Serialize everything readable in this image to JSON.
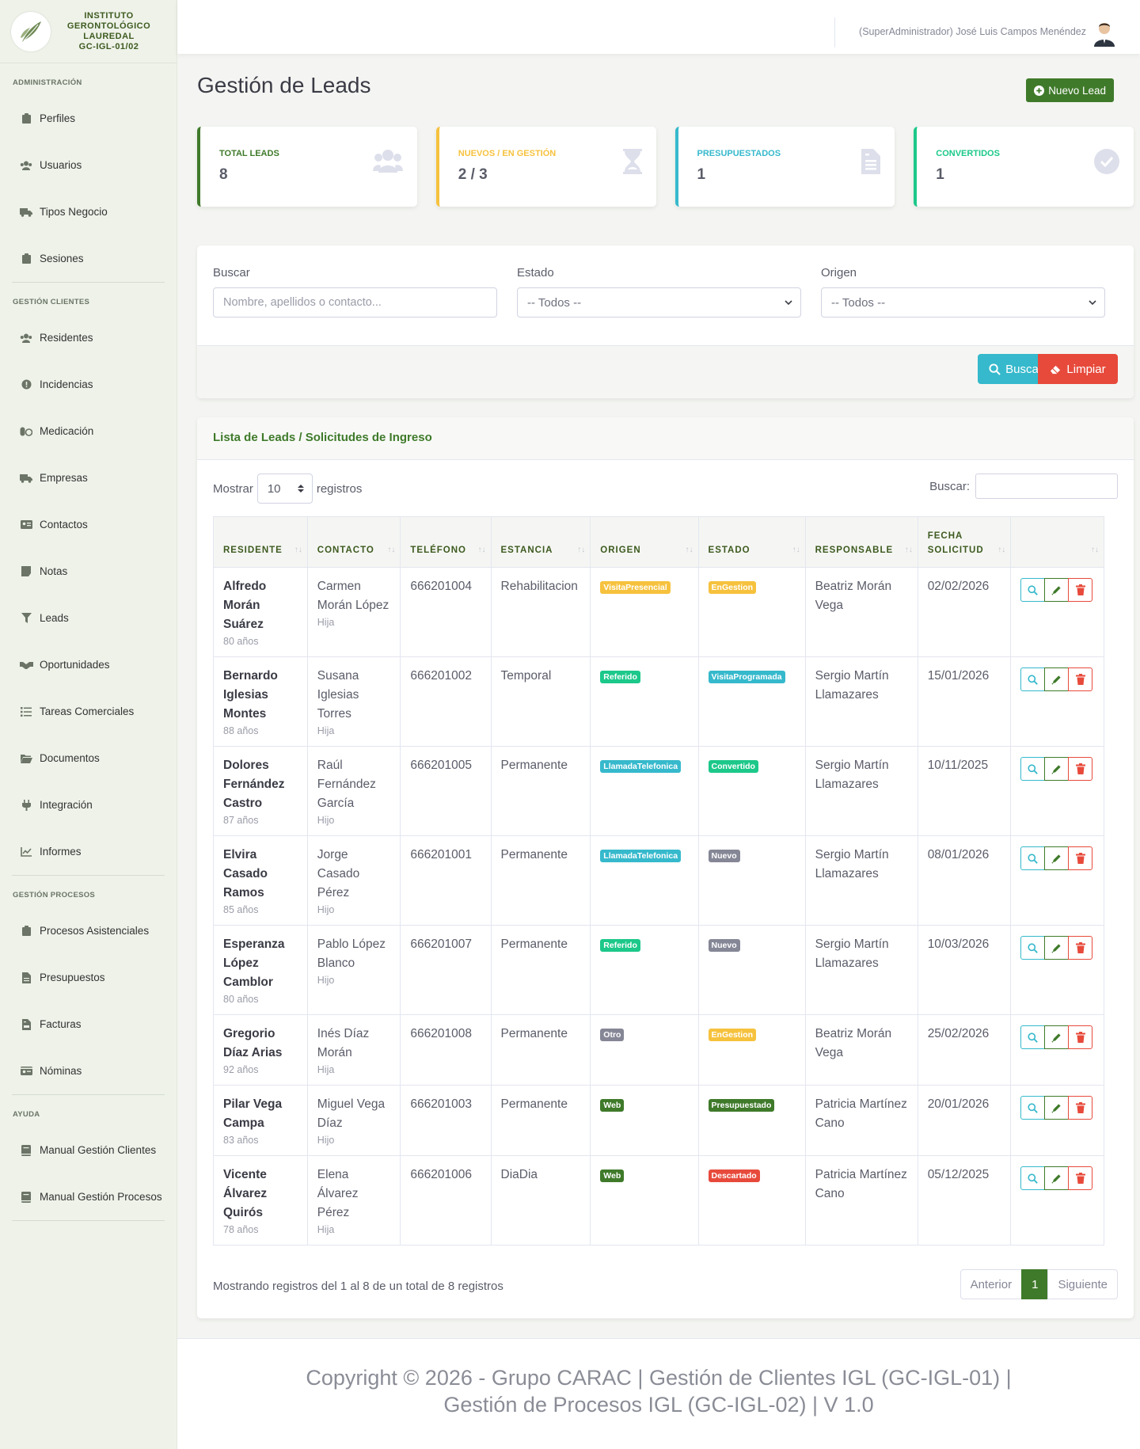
{
  "brand": {
    "line1": "INSTITUTO",
    "line2": "GERONTOLÓGICO",
    "line3": "LAUREDAL",
    "line4": "GC-IGL-01/02"
  },
  "sidebar": {
    "sections": [
      {
        "title": "ADMINISTRACIÓN",
        "items": [
          {
            "label": "Perfiles",
            "icon": "clipboard-icon"
          },
          {
            "label": "Usuarios",
            "icon": "users-icon"
          },
          {
            "label": "Tipos Negocio",
            "icon": "truck-icon"
          },
          {
            "label": "Sesiones",
            "icon": "clipboard-icon"
          }
        ]
      },
      {
        "title": "GESTIÓN CLIENTES",
        "items": [
          {
            "label": "Residentes",
            "icon": "users-icon"
          },
          {
            "label": "Incidencias",
            "icon": "alert-circle-icon"
          },
          {
            "label": "Medicación",
            "icon": "pills-icon"
          },
          {
            "label": "Empresas",
            "icon": "truck-icon"
          },
          {
            "label": "Contactos",
            "icon": "address-card-icon"
          },
          {
            "label": "Notas",
            "icon": "note-icon"
          },
          {
            "label": "Leads",
            "icon": "funnel-icon"
          },
          {
            "label": "Oportunidades",
            "icon": "handshake-icon"
          },
          {
            "label": "Tareas Comerciales",
            "icon": "list-icon"
          },
          {
            "label": "Documentos",
            "icon": "folder-icon"
          },
          {
            "label": "Integración",
            "icon": "plug-icon"
          },
          {
            "label": "Informes",
            "icon": "chart-line-icon"
          }
        ]
      },
      {
        "title": "GESTIÓN PROCESOS",
        "items": [
          {
            "label": "Procesos Asistenciales",
            "icon": "clipboard-icon"
          },
          {
            "label": "Presupuestos",
            "icon": "file-icon"
          },
          {
            "label": "Facturas",
            "icon": "invoice-icon"
          },
          {
            "label": "Nóminas",
            "icon": "id-card-icon"
          }
        ]
      },
      {
        "title": "AYUDA",
        "items": [
          {
            "label": "Manual Gestión Clientes",
            "icon": "book-icon"
          },
          {
            "label": "Manual Gestión Procesos",
            "icon": "book-icon"
          }
        ]
      }
    ]
  },
  "topbar": {
    "user": "(SuperAdministrador) José Luis Campos Menéndez"
  },
  "page": {
    "title": "Gestión de Leads",
    "new_button": "Nuevo Lead"
  },
  "stats": [
    {
      "label": "TOTAL LEADS",
      "value": "8",
      "color": "#3f7a2a",
      "icon": "users-icon"
    },
    {
      "label": "NUEVOS / EN GESTIÓN",
      "value": "2 / 3",
      "color": "#f6c23e",
      "icon": "hourglass-icon"
    },
    {
      "label": "PRESUPUESTADOS",
      "value": "1",
      "color": "#36b9cc",
      "icon": "file-icon"
    },
    {
      "label": "CONVERTIDOS",
      "value": "1",
      "color": "#1cc88a",
      "icon": "check-circle-icon"
    }
  ],
  "filters": {
    "search_label": "Buscar",
    "search_placeholder": "Nombre, apellidos o contacto...",
    "estado_label": "Estado",
    "estado_value": "-- Todos --",
    "origen_label": "Origen",
    "origen_value": "-- Todos --",
    "buscar_button": "Buscar",
    "limpiar_button": "Limpiar"
  },
  "list": {
    "title": "Lista de Leads / Solicitudes de Ingreso",
    "show_label": "Mostrar",
    "show_value": "10",
    "records_label": "registros",
    "search_label": "Buscar:",
    "columns": [
      "RESIDENTE",
      "CONTACTO",
      "TELÉFONO",
      "ESTANCIA",
      "ORIGEN",
      "ESTADO",
      "RESPONSABLE",
      "FECHA SOLICITUD"
    ],
    "rows": [
      {
        "name": "Alfredo Morán Suárez",
        "age": "80 años",
        "contact": "Carmen Morán López",
        "relation": "Hija",
        "phone": "666201004",
        "stay": "Rehabilitacion",
        "origin": "VisitaPresencial",
        "origin_color": "#f6c23e",
        "status": "EnGestion",
        "status_color": "#f6c23e",
        "owner": "Beatriz Morán Vega",
        "date": "02/02/2026"
      },
      {
        "name": "Bernardo Iglesias Montes",
        "age": "88 años",
        "contact": "Susana Iglesias Torres",
        "relation": "Hija",
        "phone": "666201002",
        "stay": "Temporal",
        "origin": "Referido",
        "origin_color": "#1cc88a",
        "status": "VisitaProgramada",
        "status_color": "#36b9cc",
        "owner": "Sergio Martín Llamazares",
        "date": "15/01/2026"
      },
      {
        "name": "Dolores Fernández Castro",
        "age": "87 años",
        "contact": "Raúl Fernández García",
        "relation": "Hijo",
        "phone": "666201005",
        "stay": "Permanente",
        "origin": "LlamadaTelefonica",
        "origin_color": "#36b9cc",
        "status": "Convertido",
        "status_color": "#1cc88a",
        "owner": "Sergio Martín Llamazares",
        "date": "10/11/2025"
      },
      {
        "name": "Elvira Casado Ramos",
        "age": "85 años",
        "contact": "Jorge Casado Pérez",
        "relation": "Hijo",
        "phone": "666201001",
        "stay": "Permanente",
        "origin": "LlamadaTelefonica",
        "origin_color": "#36b9cc",
        "status": "Nuevo",
        "status_color": "#858796",
        "owner": "Sergio Martín Llamazares",
        "date": "08/01/2026"
      },
      {
        "name": "Esperanza López Camblor",
        "age": "80 años",
        "contact": "Pablo López Blanco",
        "relation": "Hijo",
        "phone": "666201007",
        "stay": "Permanente",
        "origin": "Referido",
        "origin_color": "#1cc88a",
        "status": "Nuevo",
        "status_color": "#858796",
        "owner": "Sergio Martín Llamazares",
        "date": "10/03/2026"
      },
      {
        "name": "Gregorio Díaz Arias",
        "age": "92 años",
        "contact": "Inés Díaz Morán",
        "relation": "Hija",
        "phone": "666201008",
        "stay": "Permanente",
        "origin": "Otro",
        "origin_color": "#858796",
        "status": "EnGestion",
        "status_color": "#f6c23e",
        "owner": "Beatriz Morán Vega",
        "date": "25/02/2026"
      },
      {
        "name": "Pilar Vega Campa",
        "age": "83 años",
        "contact": "Miguel Vega Díaz",
        "relation": "Hijo",
        "phone": "666201003",
        "stay": "Permanente",
        "origin": "Web",
        "origin_color": "#3f7a2a",
        "status": "Presupuestado",
        "status_color": "#3f7a2a",
        "owner": "Patricia Martínez Cano",
        "date": "20/01/2026"
      },
      {
        "name": "Vicente Álvarez Quirós",
        "age": "78 años",
        "contact": "Elena Álvarez Pérez",
        "relation": "Hija",
        "phone": "666201006",
        "stay": "DiaDia",
        "origin": "Web",
        "origin_color": "#3f7a2a",
        "status": "Descartado",
        "status_color": "#e74a3b",
        "owner": "Patricia Martínez Cano",
        "date": "05/12/2025"
      }
    ],
    "info": "Mostrando registros del 1 al 8 de un total de 8 registros",
    "prev": "Anterior",
    "page": "1",
    "next": "Siguiente"
  },
  "footer": {
    "text": "Copyright © 2026 - Grupo CARAC | Gestión de Clientes IGL (GC-IGL-01) | Gestión de Procesos IGL (GC-IGL-02) | V 1.0"
  }
}
